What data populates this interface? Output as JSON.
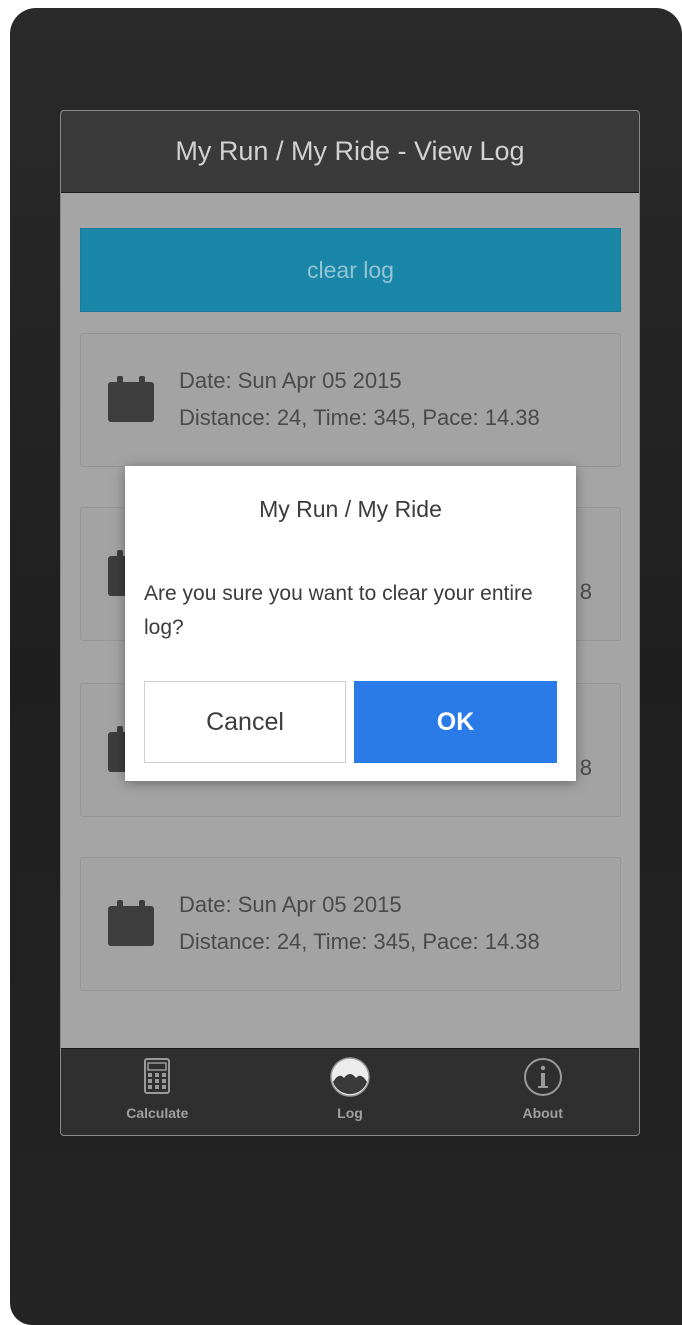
{
  "header": {
    "title": "My Run / My Ride - View Log"
  },
  "actions": {
    "clear_log_label": "clear log"
  },
  "log_entries": [
    {
      "date": "Date: Sun Apr 05 2015",
      "details": "Distance: 24, Time: 345, Pace: 14.38"
    },
    {
      "details_peek": "8"
    },
    {
      "details_peek": "8"
    },
    {
      "date": "Date: Sun Apr 05 2015",
      "details": "Distance: 24, Time: 345, Pace: 14.38"
    }
  ],
  "tabs": [
    {
      "label": "Calculate",
      "icon": "calculator-icon"
    },
    {
      "label": "Log",
      "icon": "log-icon"
    },
    {
      "label": "About",
      "icon": "info-icon"
    }
  ],
  "dialog": {
    "title": "My Run / My Ride",
    "message": "Are you sure you want to clear your entire log?",
    "cancel_label": "Cancel",
    "ok_label": "OK"
  },
  "colors": {
    "accent": "#1a86a8",
    "ok_button": "#2a7be8",
    "header_bg": "#3a3a3a"
  }
}
